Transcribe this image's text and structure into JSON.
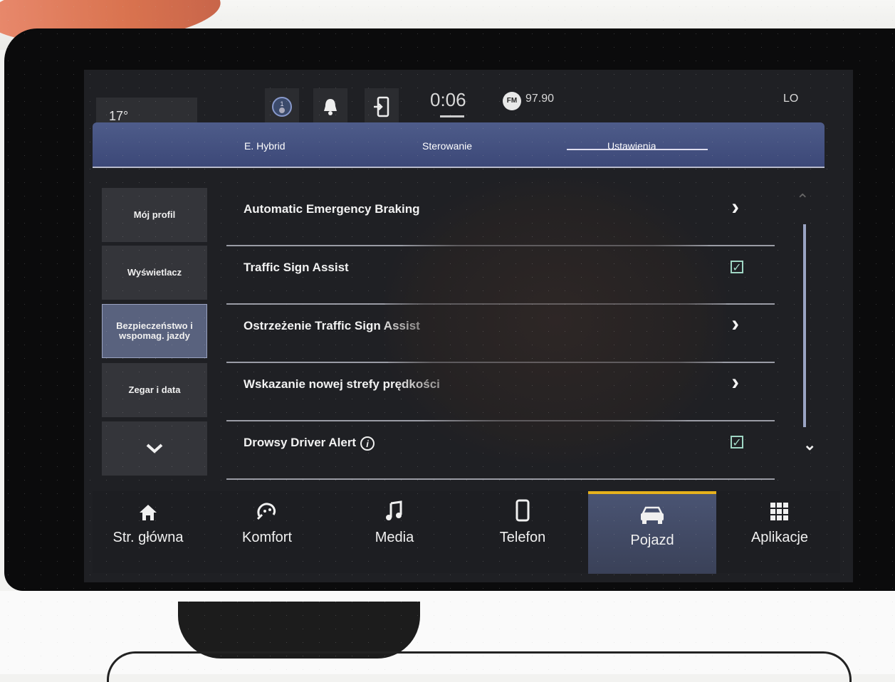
{
  "status": {
    "temperature": "17°",
    "time": "0:06",
    "radio_band": "FM",
    "radio_freq": "97.90",
    "right_label": "LO",
    "icons": [
      "driver-profile-icon",
      "bell-icon",
      "phone-connect-icon"
    ]
  },
  "tabs": [
    {
      "label": "E. Hybrid"
    },
    {
      "label": "Sterowanie"
    },
    {
      "label": "Ustawienia",
      "active": true
    }
  ],
  "sidebar": {
    "items": [
      {
        "label": "Mój profil"
      },
      {
        "label": "Wyświetlacz"
      },
      {
        "label": "Bezpieczeństwo i wspomag. jazdy",
        "active": true
      },
      {
        "label": "Zegar i data"
      }
    ],
    "more_glyph": "⌄"
  },
  "settings": {
    "rows": [
      {
        "label": "Automatic Emergency Braking",
        "control": "chevron"
      },
      {
        "label": "Traffic Sign Assist",
        "control": "checkbox",
        "checked": true
      },
      {
        "label": "Ostrzeżenie Traffic Sign Assist",
        "control": "chevron"
      },
      {
        "label": "Wskazanie nowej strefy prędkości",
        "control": "chevron"
      },
      {
        "label": "Drowsy Driver Alert",
        "control": "checkbox",
        "checked": true,
        "info": true
      }
    ]
  },
  "nav": {
    "items": [
      {
        "label": "Str. główna",
        "icon": "home-icon"
      },
      {
        "label": "Komfort",
        "icon": "comfort-icon"
      },
      {
        "label": "Media",
        "icon": "music-note-icon"
      },
      {
        "label": "Telefon",
        "icon": "phone-icon"
      },
      {
        "label": "Pojazd",
        "icon": "car-icon",
        "active": true
      },
      {
        "label": "Aplikacje",
        "icon": "apps-grid-icon"
      }
    ]
  },
  "colors": {
    "tab_bar": "#4e5c8a",
    "active_nav_accent": "#e6b21c",
    "checkbox": "#9fd6c4"
  }
}
